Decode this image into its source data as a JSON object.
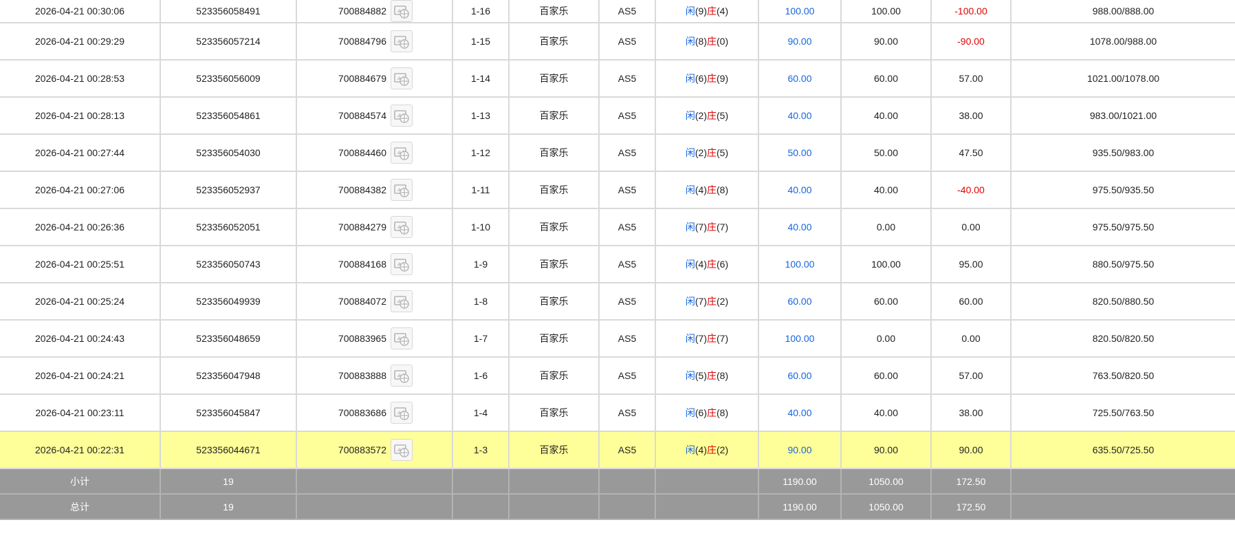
{
  "colors": {
    "player": "#1565e0",
    "banker": "#e00000",
    "highlight": "#ffff99",
    "summary_bg": "#999999"
  },
  "rows": [
    {
      "time": "2026-04-21 00:30:06",
      "bet_id": "523356058491",
      "game_id": "700884882",
      "round": "1-16",
      "game": "百家乐",
      "table": "AS5",
      "player_label": "闲",
      "player_val": "(9)",
      "banker_label": "庄",
      "banker_val": "(4)",
      "bet_amount": "100.00",
      "valid_bet": "100.00",
      "payout": "-100.00",
      "payout_negative": true,
      "balance": "988.00/888.00",
      "icon": "game-record-icon",
      "highlight": false
    },
    {
      "time": "2026-04-21 00:29:29",
      "bet_id": "523356057214",
      "game_id": "700884796",
      "round": "1-15",
      "game": "百家乐",
      "table": "AS5",
      "player_label": "闲",
      "player_val": "(8)",
      "banker_label": "庄",
      "banker_val": "(0)",
      "bet_amount": "90.00",
      "valid_bet": "90.00",
      "payout": "-90.00",
      "payout_negative": true,
      "balance": "1078.00/988.00",
      "icon": "game-record-icon",
      "highlight": false
    },
    {
      "time": "2026-04-21 00:28:53",
      "bet_id": "523356056009",
      "game_id": "700884679",
      "round": "1-14",
      "game": "百家乐",
      "table": "AS5",
      "player_label": "闲",
      "player_val": "(6)",
      "banker_label": "庄",
      "banker_val": "(9)",
      "bet_amount": "60.00",
      "valid_bet": "60.00",
      "payout": "57.00",
      "payout_negative": false,
      "balance": "1021.00/1078.00",
      "icon": "game-record-icon",
      "highlight": false
    },
    {
      "time": "2026-04-21 00:28:13",
      "bet_id": "523356054861",
      "game_id": "700884574",
      "round": "1-13",
      "game": "百家乐",
      "table": "AS5",
      "player_label": "闲",
      "player_val": "(2)",
      "banker_label": "庄",
      "banker_val": "(5)",
      "bet_amount": "40.00",
      "valid_bet": "40.00",
      "payout": "38.00",
      "payout_negative": false,
      "balance": "983.00/1021.00",
      "icon": "game-record-icon",
      "highlight": false
    },
    {
      "time": "2026-04-21 00:27:44",
      "bet_id": "523356054030",
      "game_id": "700884460",
      "round": "1-12",
      "game": "百家乐",
      "table": "AS5",
      "player_label": "闲",
      "player_val": "(2)",
      "banker_label": "庄",
      "banker_val": "(5)",
      "bet_amount": "50.00",
      "valid_bet": "50.00",
      "payout": "47.50",
      "payout_negative": false,
      "balance": "935.50/983.00",
      "icon": "game-record-icon",
      "highlight": false
    },
    {
      "time": "2026-04-21 00:27:06",
      "bet_id": "523356052937",
      "game_id": "700884382",
      "round": "1-11",
      "game": "百家乐",
      "table": "AS5",
      "player_label": "闲",
      "player_val": "(4)",
      "banker_label": "庄",
      "banker_val": "(8)",
      "bet_amount": "40.00",
      "valid_bet": "40.00",
      "payout": "-40.00",
      "payout_negative": true,
      "balance": "975.50/935.50",
      "icon": "game-record-icon",
      "highlight": false
    },
    {
      "time": "2026-04-21 00:26:36",
      "bet_id": "523356052051",
      "game_id": "700884279",
      "round": "1-10",
      "game": "百家乐",
      "table": "AS5",
      "player_label": "闲",
      "player_val": "(7)",
      "banker_label": "庄",
      "banker_val": "(7)",
      "bet_amount": "40.00",
      "valid_bet": "0.00",
      "payout": "0.00",
      "payout_negative": false,
      "balance": "975.50/975.50",
      "icon": "game-record-icon",
      "highlight": false
    },
    {
      "time": "2026-04-21 00:25:51",
      "bet_id": "523356050743",
      "game_id": "700884168",
      "round": "1-9",
      "game": "百家乐",
      "table": "AS5",
      "player_label": "闲",
      "player_val": "(4)",
      "banker_label": "庄",
      "banker_val": "(6)",
      "bet_amount": "100.00",
      "valid_bet": "100.00",
      "payout": "95.00",
      "payout_negative": false,
      "balance": "880.50/975.50",
      "icon": "game-record-icon",
      "highlight": false
    },
    {
      "time": "2026-04-21 00:25:24",
      "bet_id": "523356049939",
      "game_id": "700884072",
      "round": "1-8",
      "game": "百家乐",
      "table": "AS5",
      "player_label": "闲",
      "player_val": "(7)",
      "banker_label": "庄",
      "banker_val": "(2)",
      "bet_amount": "60.00",
      "valid_bet": "60.00",
      "payout": "60.00",
      "payout_negative": false,
      "balance": "820.50/880.50",
      "icon": "game-record-icon",
      "highlight": false
    },
    {
      "time": "2026-04-21 00:24:43",
      "bet_id": "523356048659",
      "game_id": "700883965",
      "round": "1-7",
      "game": "百家乐",
      "table": "AS5",
      "player_label": "闲",
      "player_val": "(7)",
      "banker_label": "庄",
      "banker_val": "(7)",
      "bet_amount": "100.00",
      "valid_bet": "0.00",
      "payout": "0.00",
      "payout_negative": false,
      "balance": "820.50/820.50",
      "icon": "game-record-icon",
      "highlight": false
    },
    {
      "time": "2026-04-21 00:24:21",
      "bet_id": "523356047948",
      "game_id": "700883888",
      "round": "1-6",
      "game": "百家乐",
      "table": "AS5",
      "player_label": "闲",
      "player_val": "(5)",
      "banker_label": "庄",
      "banker_val": "(8)",
      "bet_amount": "60.00",
      "valid_bet": "60.00",
      "payout": "57.00",
      "payout_negative": false,
      "balance": "763.50/820.50",
      "icon": "game-record-icon",
      "highlight": false
    },
    {
      "time": "2026-04-21 00:23:11",
      "bet_id": "523356045847",
      "game_id": "700883686",
      "round": "1-4",
      "game": "百家乐",
      "table": "AS5",
      "player_label": "闲",
      "player_val": "(6)",
      "banker_label": "庄",
      "banker_val": "(8)",
      "bet_amount": "40.00",
      "valid_bet": "40.00",
      "payout": "38.00",
      "payout_negative": false,
      "balance": "725.50/763.50",
      "icon": "game-record-icon",
      "highlight": false
    },
    {
      "time": "2026-04-21 00:22:31",
      "bet_id": "523356044671",
      "game_id": "700883572",
      "round": "1-3",
      "game": "百家乐",
      "table": "AS5",
      "player_label": "闲",
      "player_val": "(4)",
      "banker_label": "庄",
      "banker_val": "(2)",
      "bet_amount": "90.00",
      "valid_bet": "90.00",
      "payout": "90.00",
      "payout_negative": false,
      "balance": "635.50/725.50",
      "icon": "game-record-icon",
      "highlight": true
    }
  ],
  "summary": [
    {
      "label": "小计",
      "count": "19",
      "bet_amount": "1190.00",
      "valid_bet": "1050.00",
      "payout": "172.50"
    },
    {
      "label": "总计",
      "count": "19",
      "bet_amount": "1190.00",
      "valid_bet": "1050.00",
      "payout": "172.50"
    }
  ]
}
